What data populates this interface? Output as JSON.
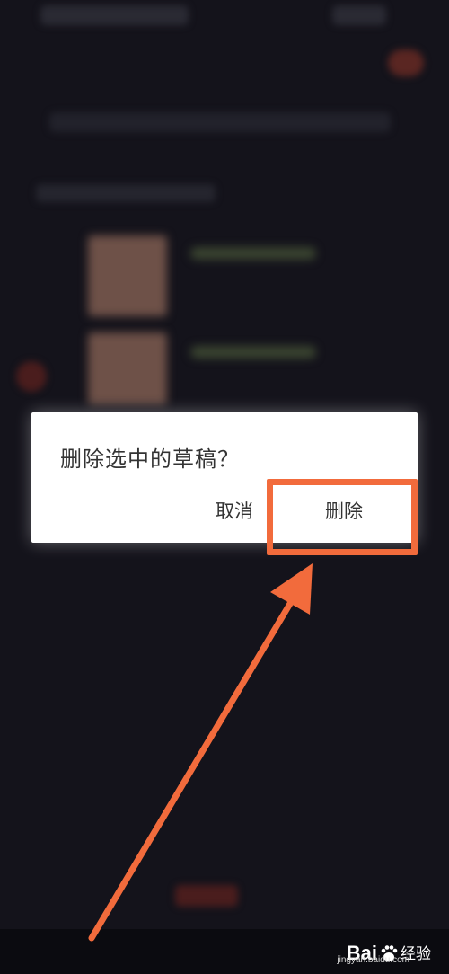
{
  "dialog": {
    "title": "删除选中的草稿？",
    "cancel_label": "取消",
    "delete_label": "删除"
  },
  "annotation": {
    "highlight_color": "#f26b3c",
    "arrow_color": "#f26b3c"
  },
  "watermark": {
    "brand": "Bai",
    "brand_suffix": "经验",
    "url": "jingyan.baidu.com"
  }
}
